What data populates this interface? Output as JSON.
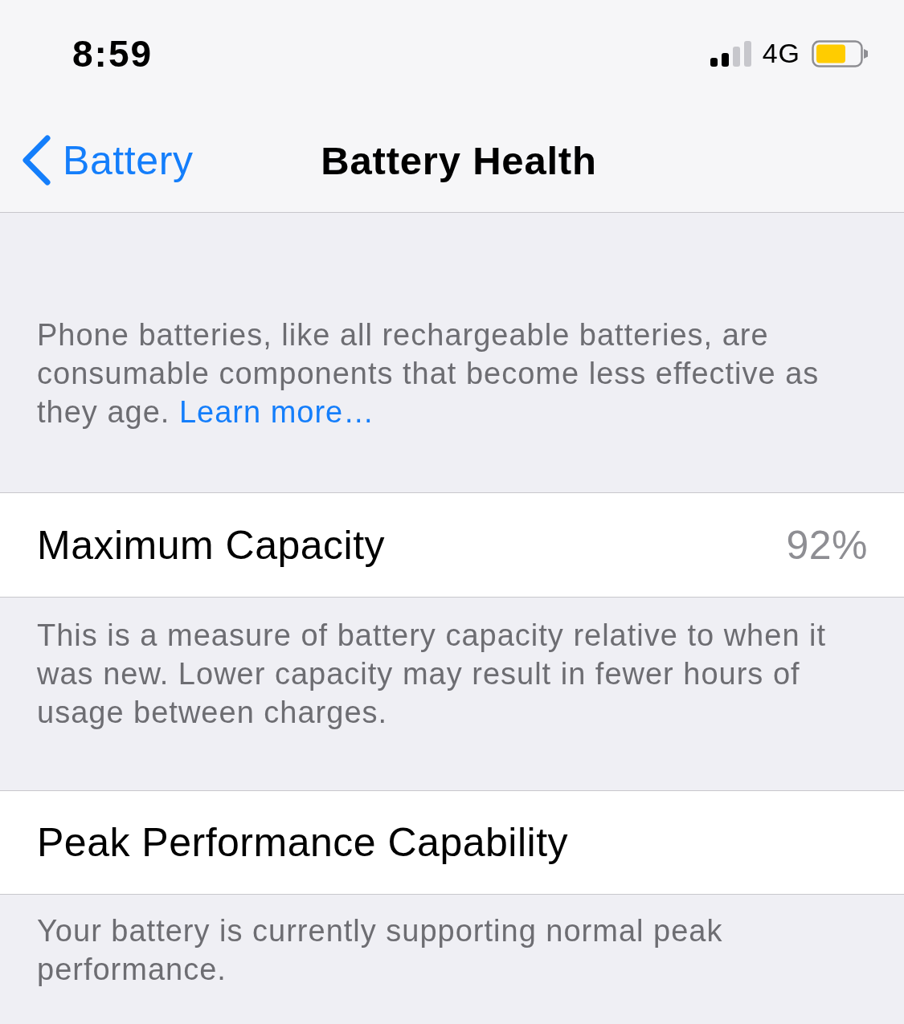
{
  "status_bar": {
    "time": "8:59",
    "network": "4G"
  },
  "nav_bar": {
    "back_label": "Battery",
    "title": "Battery Health"
  },
  "intro": {
    "text": "Phone batteries, like all rechargeable batteries, are consumable components that become less effective as they age.",
    "link": "Learn more…"
  },
  "sections": [
    {
      "label": "Maximum Capacity",
      "value": "92%",
      "footer": "This is a measure of battery capacity relative to when it was new. Lower capacity may result in fewer hours of usage between charges."
    },
    {
      "label": "Peak Performance Capability",
      "footer": "Your battery is currently supporting normal peak performance."
    }
  ]
}
